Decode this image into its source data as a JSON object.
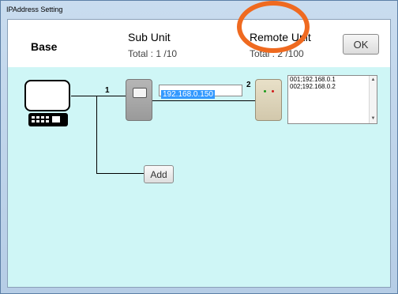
{
  "window": {
    "title": "IPAddress Setting"
  },
  "header": {
    "base_label": "Base",
    "sub_unit": {
      "title": "Sub Unit",
      "total_text": "Total :  1  /10"
    },
    "remote_unit": {
      "title": "Remote Unit",
      "total_text": "Total :  2  /100"
    },
    "ok_label": "OK"
  },
  "diagram": {
    "connection_1": "1",
    "connection_2": "2",
    "sub_unit_ip": "192.168.0.150",
    "remote_list": [
      "001;192.168.0.1",
      "002;192.168.0.2"
    ],
    "add_label": "Add"
  },
  "colors": {
    "canvas_bg": "#cff6f6",
    "highlight_ring": "#ef6a20",
    "selection": "#3399ff"
  }
}
